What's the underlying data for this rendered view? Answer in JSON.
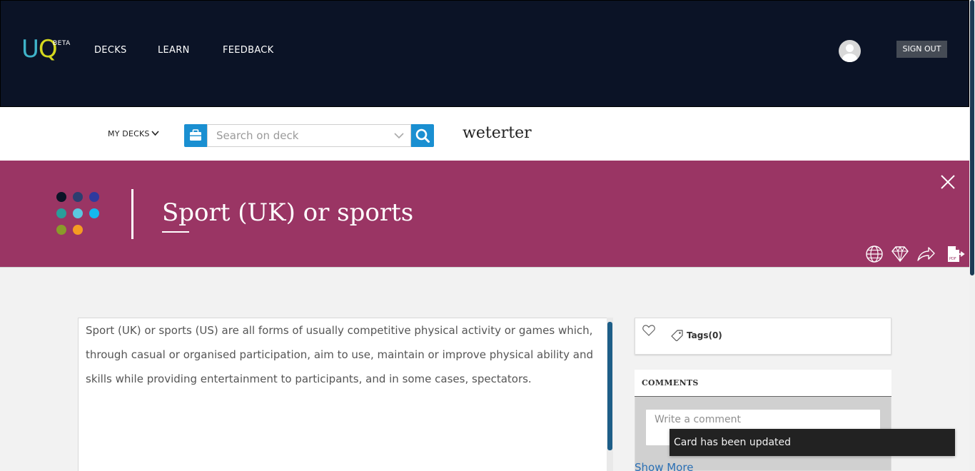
{
  "header": {
    "logo_u": "U",
    "logo_q": "Q",
    "logo_badge": "BETA",
    "nav": [
      "DECKS",
      "LEARN",
      "FEEDBACK"
    ],
    "sign_out": "SIGN OUT"
  },
  "search": {
    "my_decks": "MY DECKS",
    "placeholder": "Search on deck",
    "deck_name": "weterter"
  },
  "card": {
    "title": "Sport (UK) or sports",
    "body": "Sport (UK) or sports (US) are all forms of usually competitive physical activity or games which, through casual or organised participation, aim to use, maintain or improve physical ability and skills while providing entertainment to participants, and in some cases, spectators.",
    "palette": [
      "#0b1326",
      "#2c3e70",
      "#2e3a9e",
      "#2a9d9a",
      "#5bc7e0",
      "#14b8ee",
      "#8a9a2a",
      "#f59b22"
    ],
    "banner_color": "#9a3564",
    "actions": [
      "globe-icon",
      "diamond-icon",
      "share-icon",
      "export-pdf-icon"
    ]
  },
  "sidebar": {
    "tags_label": "Tags(0)",
    "comments_title": "COMMENTS",
    "comment_placeholder": "Write a comment",
    "show_more": "Show More"
  },
  "toast": {
    "message": "Card has been updated"
  }
}
